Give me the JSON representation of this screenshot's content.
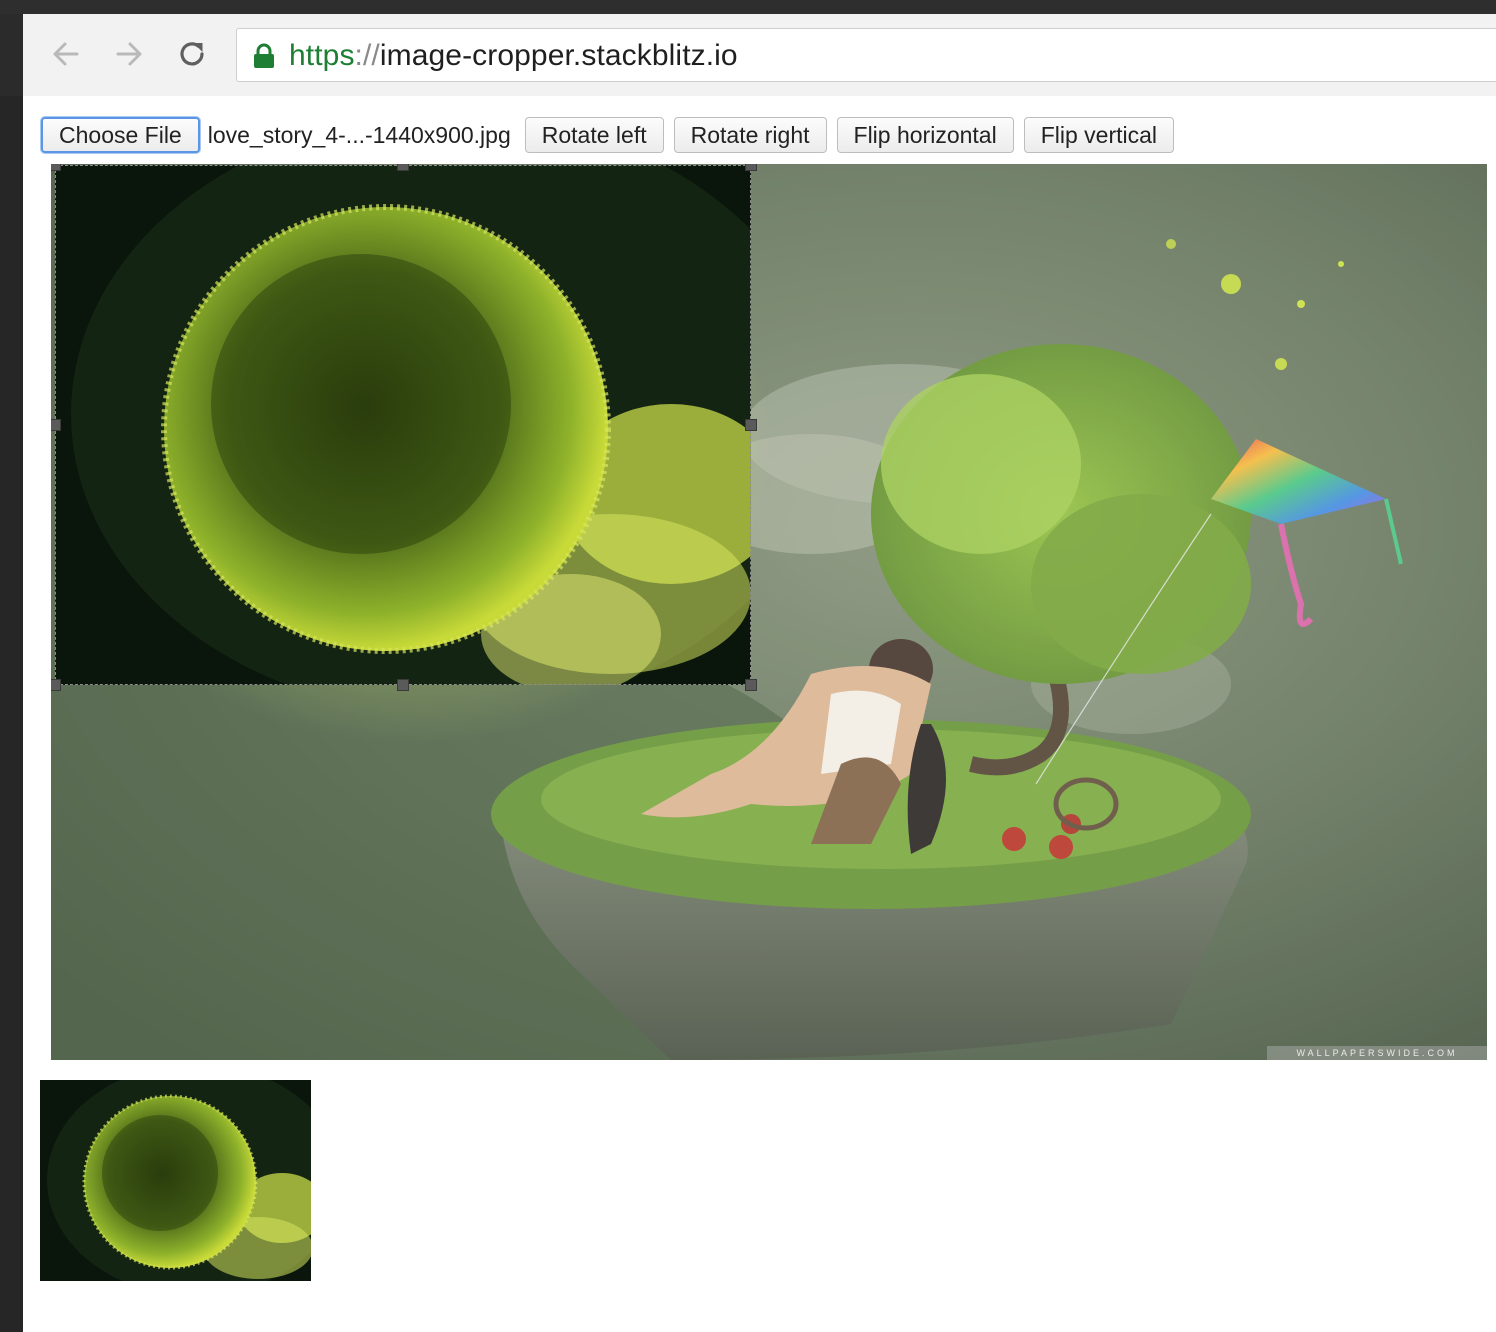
{
  "browser": {
    "url_scheme": "https",
    "url_separator": "://",
    "url_host": "image-cropper.stackblitz.io"
  },
  "controls": {
    "choose_file_label": "Choose File",
    "file_name": "love_story_4-...-1440x900.jpg",
    "rotate_left_label": "Rotate left",
    "rotate_right_label": "Rotate right",
    "flip_horizontal_label": "Flip horizontal",
    "flip_vertical_label": "Flip vertical"
  },
  "image": {
    "watermark": "WALLPAPERSWIDE.COM"
  },
  "colors": {
    "accent_focus": "#5b96e6",
    "secure_green": "#1e7e34"
  }
}
